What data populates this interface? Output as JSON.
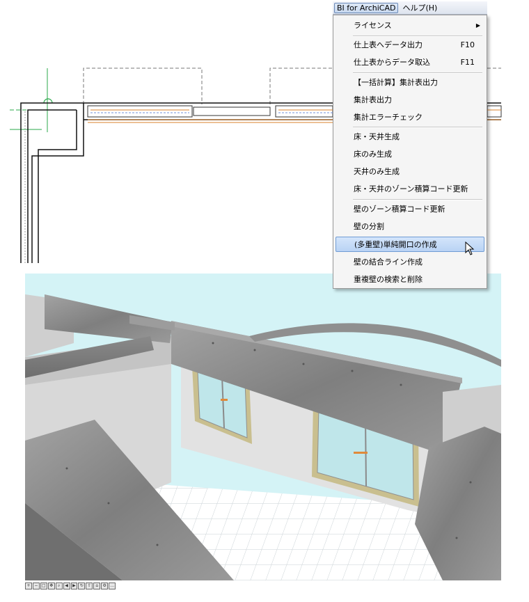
{
  "menubar": {
    "items": [
      {
        "label": "BI for ArchiCAD",
        "active": true
      },
      {
        "label": "ヘルプ(H)",
        "active": false
      }
    ]
  },
  "dropdown": {
    "items": [
      {
        "label": "ライセンス",
        "shortcut": "",
        "submenu": true
      },
      {
        "label": "仕上表へデータ出力",
        "shortcut": "F10"
      },
      {
        "label": "仕上表からデータ取込",
        "shortcut": "F11"
      },
      {
        "label": "【一括計算】集計表出力",
        "shortcut": ""
      },
      {
        "label": "集計表出力",
        "shortcut": ""
      },
      {
        "label": "集計エラーチェック",
        "shortcut": ""
      },
      {
        "label": "床・天井生成",
        "shortcut": ""
      },
      {
        "label": "床のみ生成",
        "shortcut": ""
      },
      {
        "label": "天井のみ生成",
        "shortcut": ""
      },
      {
        "label": "床・天井のゾーン積算コード更新",
        "shortcut": ""
      },
      {
        "label": "壁のゾーン積算コード更新",
        "shortcut": ""
      },
      {
        "label": "壁の分割",
        "shortcut": ""
      },
      {
        "label": "(多重壁)単純開口の作成",
        "shortcut": "",
        "highlighted": true
      },
      {
        "label": "壁の結合ライン作成",
        "shortcut": ""
      },
      {
        "label": "重複壁の検索と削除",
        "shortcut": ""
      }
    ]
  },
  "colors": {
    "menu_highlight": "#b9d3f4",
    "sky": "#d4f3f6",
    "concrete": "#8e8e8e",
    "wall": "#dcdcdc",
    "glass": "#bfe6ea",
    "frame": "#c9bf8f",
    "plan_wall_orange": "#d9822b",
    "plan_green": "#2aa84a"
  },
  "icons": {
    "submenu": "triangle-right-icon",
    "cursor": "mouse-pointer-icon"
  }
}
